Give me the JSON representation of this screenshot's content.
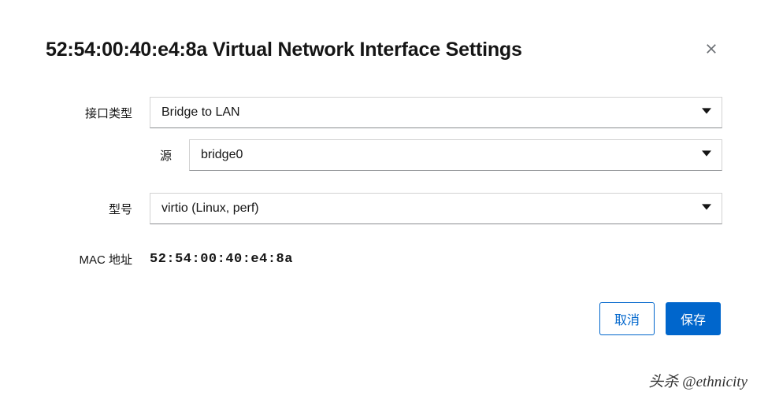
{
  "dialog": {
    "title": "52:54:00:40:e4:8a Virtual Network Interface Settings"
  },
  "form": {
    "interface_type": {
      "label": "接口类型",
      "value": "Bridge to LAN"
    },
    "source": {
      "label": "源",
      "value": "bridge0"
    },
    "model": {
      "label": "型号",
      "value": "virtio (Linux, perf)"
    },
    "mac": {
      "label": "MAC 地址",
      "value": "52:54:00:40:e4:8a"
    }
  },
  "buttons": {
    "cancel": "取消",
    "save": "保存"
  },
  "watermark": "头杀 @ethnicity"
}
